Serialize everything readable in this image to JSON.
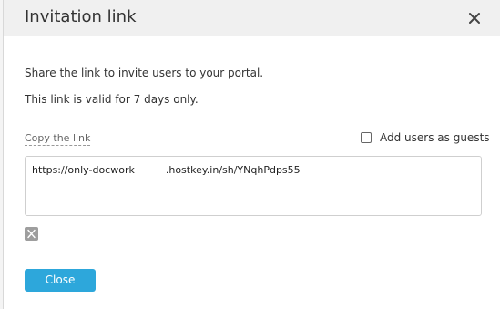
{
  "dialog": {
    "title": "Invitation link",
    "share_text": "Share the link to invite users to your portal.",
    "valid_text": "This link is valid for 7 days only.",
    "copy_link_label": "Copy the link",
    "guest_label": "Add users as guests",
    "guest_checked": false,
    "link_part1": "https://only-docwork",
    "link_part2": ".hostkey.in/sh/YNqhPdps55",
    "close_label": "Close"
  },
  "icons": {
    "close": "close-icon",
    "share": "x-twitter-icon"
  },
  "colors": {
    "accent": "#2da7db",
    "header_bg": "#f0f0f0",
    "text": "#333333"
  }
}
